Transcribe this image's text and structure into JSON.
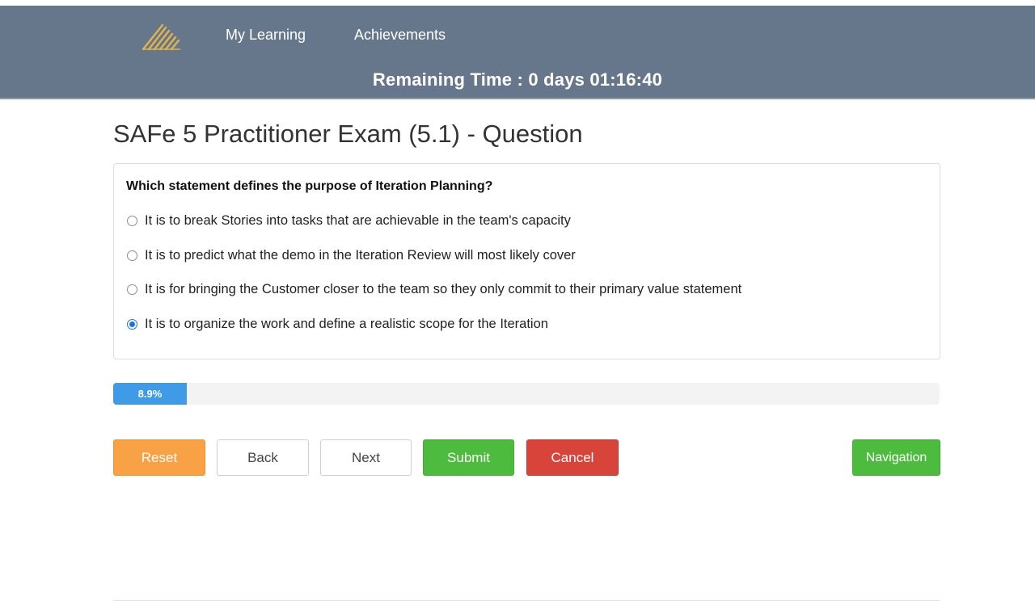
{
  "nav": {
    "logo_icon": "stripes-logo-icon",
    "links": [
      "My Learning",
      "Achievements"
    ],
    "timer_text": "Remaining Time : 0 days 01:16:40"
  },
  "page": {
    "title": "SAFe 5 Practitioner Exam (5.1) - Question"
  },
  "question": {
    "text": "Which statement defines the purpose of Iteration Planning?",
    "options": [
      {
        "label": "It is to break Stories into tasks that are achievable in the team's capacity",
        "selected": false
      },
      {
        "label": "It is to predict what the demo in the Iteration Review will most likely cover",
        "selected": false
      },
      {
        "label": "It is for bringing the Customer closer to the team so they only commit to their primary value statement",
        "selected": false
      },
      {
        "label": "It is to organize the work and define a realistic scope for the Iteration",
        "selected": true
      }
    ]
  },
  "progress": {
    "label": "8.9%",
    "value": 8.9
  },
  "buttons": {
    "reset": "Reset",
    "back": "Back",
    "next": "Next",
    "submit": "Submit",
    "cancel": "Cancel",
    "navigation": "Navigation"
  },
  "colors": {
    "navbar": "#66778c",
    "progress": "#3f9ae8",
    "reset": "#f9a245",
    "submit": "#4cbb3e",
    "cancel": "#d9443a",
    "radio_selected": "#1a73e8",
    "logo": "#e0b44a"
  }
}
